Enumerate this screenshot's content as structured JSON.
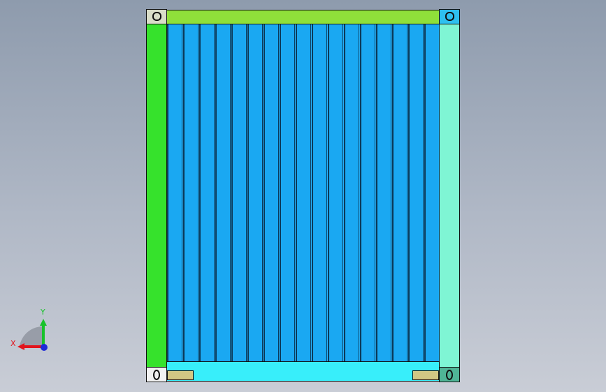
{
  "viewport": {
    "background_top": "#8e9bad",
    "background_bottom": "#c9cdd6"
  },
  "model": {
    "name": "shipping-container-end-view",
    "rib_count": 17,
    "colors": {
      "left_post": "#36e22c",
      "right_post": "#7ff5d4",
      "top_rail": "#8fe03a",
      "bottom_rail": "#38eefa",
      "panel": "#24b2fb",
      "corner_top_left": "#d9ddc8",
      "corner_top_right": "#2ec0f0",
      "corner_bottom_left": "#f2f2f2",
      "corner_bottom_right": "#4fb596",
      "forklift_pocket": "#d2c784"
    }
  },
  "triad": {
    "x_label": "X",
    "y_label": "Y",
    "x_color": "#e2141c",
    "y_color": "#18c22a",
    "z_color": "#1e2ad8"
  }
}
